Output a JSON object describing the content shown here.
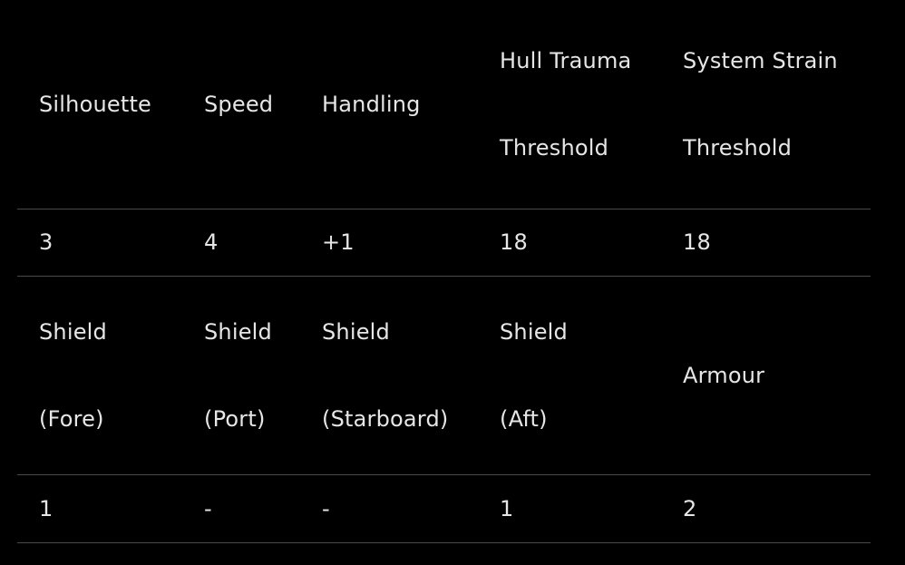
{
  "table": {
    "header_row_1": [
      {
        "lines": [
          "Silhouette"
        ]
      },
      {
        "lines": [
          "Speed"
        ]
      },
      {
        "lines": [
          "Handling"
        ]
      },
      {
        "lines": [
          "Hull Trauma",
          "Threshold"
        ]
      },
      {
        "lines": [
          "System Strain",
          "Threshold"
        ]
      }
    ],
    "values_row_1": [
      "3",
      "4",
      "+1",
      "18",
      "18"
    ],
    "header_row_2": [
      {
        "lines": [
          "Shield",
          "(Fore)"
        ]
      },
      {
        "lines": [
          "Shield",
          "(Port)"
        ]
      },
      {
        "lines": [
          "Shield",
          "(Starboard)"
        ]
      },
      {
        "lines": [
          "Shield",
          "(Aft)"
        ]
      },
      {
        "lines": [
          "Armour"
        ]
      }
    ],
    "values_row_2": [
      "1",
      "-",
      "-",
      "1",
      "2"
    ]
  }
}
